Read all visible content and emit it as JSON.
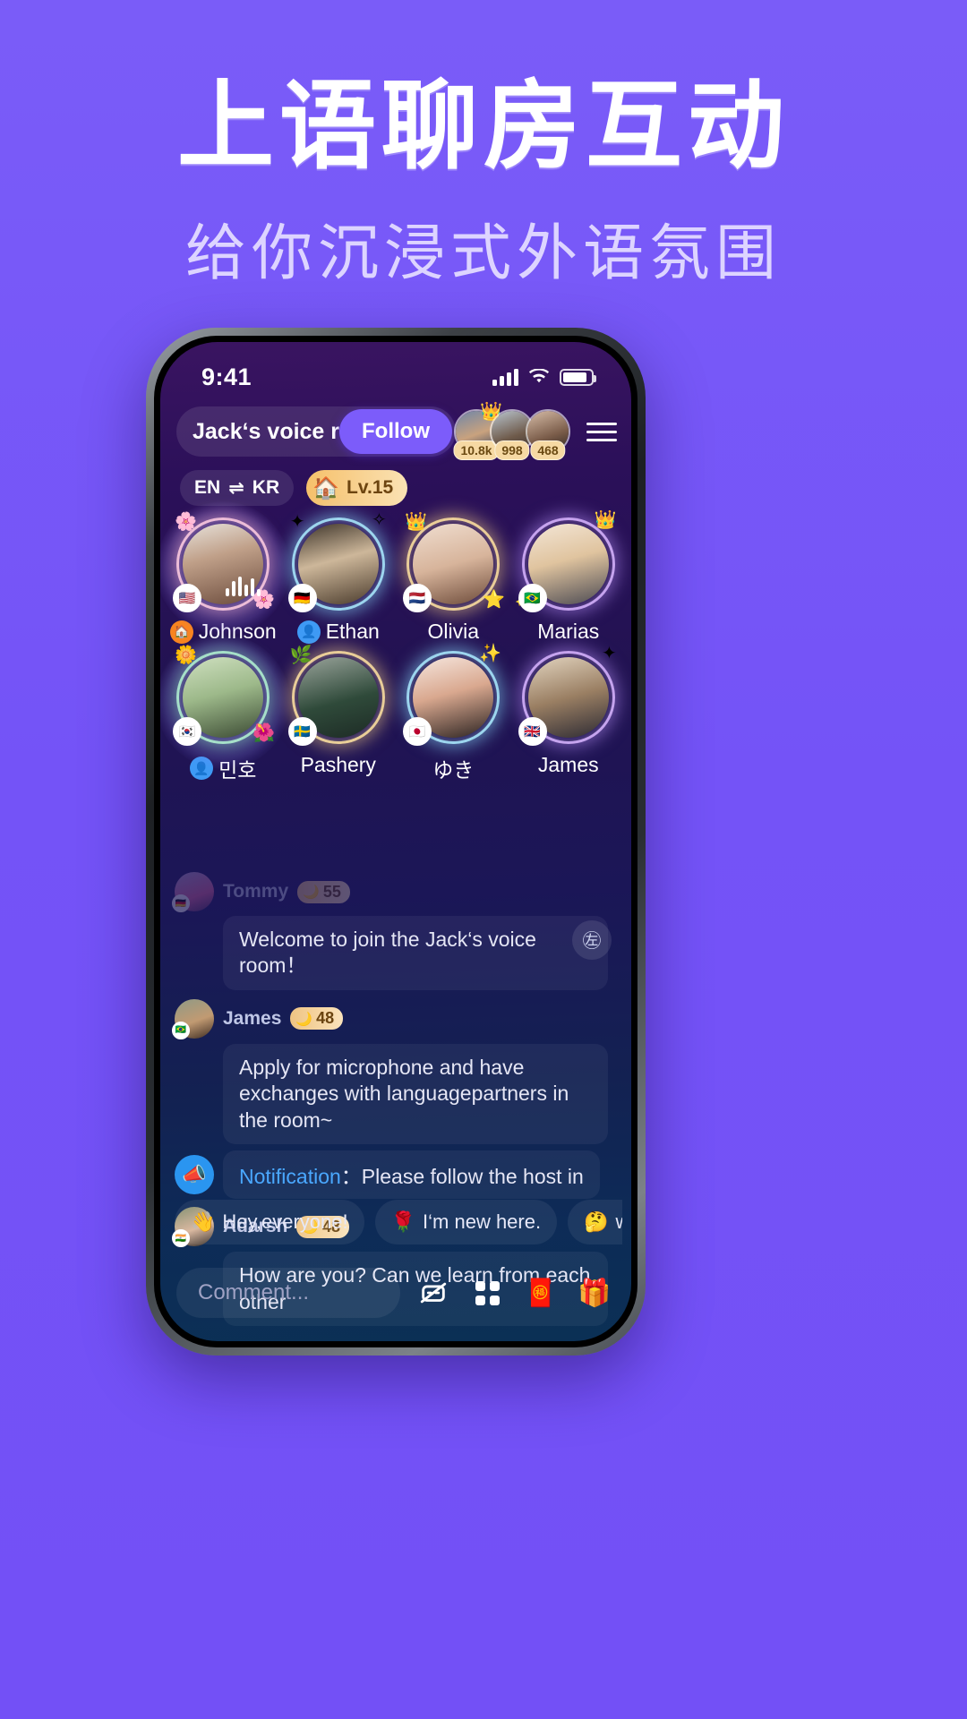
{
  "promo": {
    "headline": "上语聊房互动",
    "subheadline": "给你沉浸式外语氛围",
    "bg_color": "#7350f6"
  },
  "phone": {
    "status_bar": {
      "clock": "9:41",
      "signal_icon": "cellular-bars-icon",
      "wifi_icon": "wifi-icon",
      "battery_icon": "battery-icon"
    },
    "header": {
      "room_title": "Jack‘s voice room h",
      "follow_label": "Follow",
      "menu_icon": "hamburger-menu-icon",
      "top_fans": [
        {
          "count": "10.8k",
          "crown": "👑"
        },
        {
          "count": "998",
          "crown": ""
        },
        {
          "count": "468",
          "crown": ""
        }
      ]
    },
    "language_row": {
      "from": "EN",
      "swap_icon": "⇌",
      "to": "KR",
      "level_label": "Lv.15",
      "level_icon": "🏠"
    },
    "seats": [
      {
        "name": "Johnson",
        "flag": "🇺🇸",
        "role_icon": "host",
        "speaking": true,
        "active": true,
        "ring": "pink"
      },
      {
        "name": "Ethan",
        "flag": "🇩🇪",
        "role_icon": "user",
        "speaking": false,
        "active": false,
        "ring": "cyan"
      },
      {
        "name": "Olivia",
        "flag": "🇳🇱",
        "role_icon": "none",
        "speaking": false,
        "active": false,
        "ring": "gold"
      },
      {
        "name": "Marias",
        "flag": "🇧🇷",
        "role_icon": "none",
        "speaking": false,
        "active": false,
        "ring": "violet"
      },
      {
        "name": "민호",
        "flag": "🇰🇷",
        "role_icon": "user",
        "speaking": false,
        "active": true,
        "ring": "green"
      },
      {
        "name": "Pashery",
        "flag": "🇸🇪",
        "role_icon": "none",
        "speaking": false,
        "active": false,
        "ring": "gold"
      },
      {
        "name": "ゆき",
        "flag": "🇯🇵",
        "role_icon": "none",
        "speaking": false,
        "active": false,
        "ring": "cyan"
      },
      {
        "name": "James",
        "flag": "🇬🇧",
        "role_icon": "none",
        "speaking": false,
        "active": false,
        "ring": "violet"
      }
    ],
    "chat": {
      "translate_icon": "translate-icon",
      "messages": [
        {
          "type": "user",
          "faded": true,
          "name": "Tommy",
          "level": "55",
          "flag": "🇩🇪",
          "text": "Welcome to join the Jack‘s voice room！"
        },
        {
          "type": "user",
          "faded": false,
          "name": "James",
          "level": "48",
          "flag": "🇧🇷",
          "text": "Apply for microphone and have exchanges with languagepartners in the room~"
        },
        {
          "type": "notification",
          "label": "Notification",
          "separator": "：",
          "text": "Please follow the host in"
        },
        {
          "type": "user",
          "faded": false,
          "name": "Adarsh",
          "level": "48",
          "flag": "🇮🇳",
          "text": "How are you? Can we learn from each other"
        }
      ]
    },
    "quick_replies": [
      {
        "emoji": "👋",
        "label": "Hey,everyone!"
      },
      {
        "emoji": "🌹",
        "label": "I‘m new here."
      },
      {
        "emoji": "🤔",
        "label": "what‘s t"
      }
    ],
    "quick_close_icon": "✕",
    "input_bar": {
      "placeholder": "Comment...",
      "actions": [
        {
          "icon": "mic-off-icon"
        },
        {
          "icon": "grid-apps-icon"
        },
        {
          "icon": "red-packet-icon"
        },
        {
          "icon": "gift-icon"
        }
      ]
    }
  }
}
